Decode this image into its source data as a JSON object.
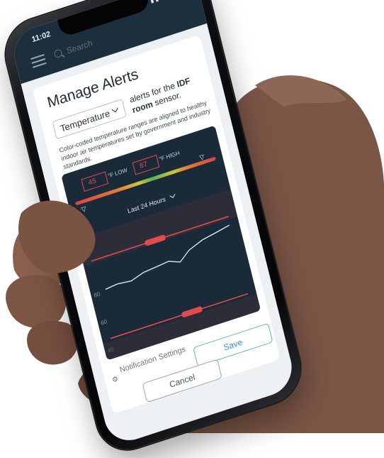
{
  "status": {
    "time": "11:02"
  },
  "topbar": {
    "search_placeholder": "Search"
  },
  "alerts": {
    "title": "Manage Alerts",
    "metric_select": "Temperature",
    "sensor_prefix": "alerts for the ",
    "sensor_name": "IDF room",
    "sensor_suffix": " sensor.",
    "description": "Color-coded temperature ranges are aligned to healthy indoor air temperatures set by government and industry standards.",
    "low_value": "45",
    "low_label": "°F LOW",
    "high_value": "87",
    "high_label": "°F HIGH",
    "period": "Last 24 Hours",
    "notification_settings": "Notification Settings",
    "save_label": "Save",
    "cancel_label": "Cancel"
  },
  "chart_data": {
    "type": "line",
    "y_ticks": [
      "80",
      "60",
      "40"
    ]
  },
  "colors": {
    "panel": "#1b2a38",
    "alert_red": "#e24b4b",
    "line": "#cfe9f5",
    "save_accent": "#3d93c9"
  }
}
